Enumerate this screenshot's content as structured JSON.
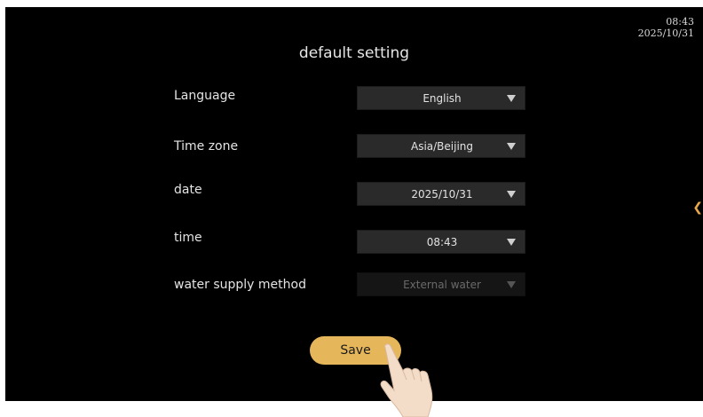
{
  "status": {
    "time": "08:43",
    "date": "2025/10/31"
  },
  "page": {
    "title": "default setting"
  },
  "settings": [
    {
      "label": "Language",
      "value": "English",
      "enabled": true
    },
    {
      "label": "Time zone",
      "value": "Asia/Beijing",
      "enabled": true
    },
    {
      "label": "date",
      "value": "2025/10/31",
      "enabled": true
    },
    {
      "label": "time",
      "value": "08:43",
      "enabled": true
    },
    {
      "label": "water supply method",
      "value": "External water",
      "enabled": false
    }
  ],
  "actions": {
    "save_label": "Save"
  },
  "colors": {
    "background": "#000000",
    "accent": "#e6b65a",
    "dropdown_bg": "#2a2a2a"
  },
  "icons": {
    "dropdown": "caret-down-icon",
    "side": "chevron-left-icon",
    "pointer": "hand-pointer-icon"
  }
}
